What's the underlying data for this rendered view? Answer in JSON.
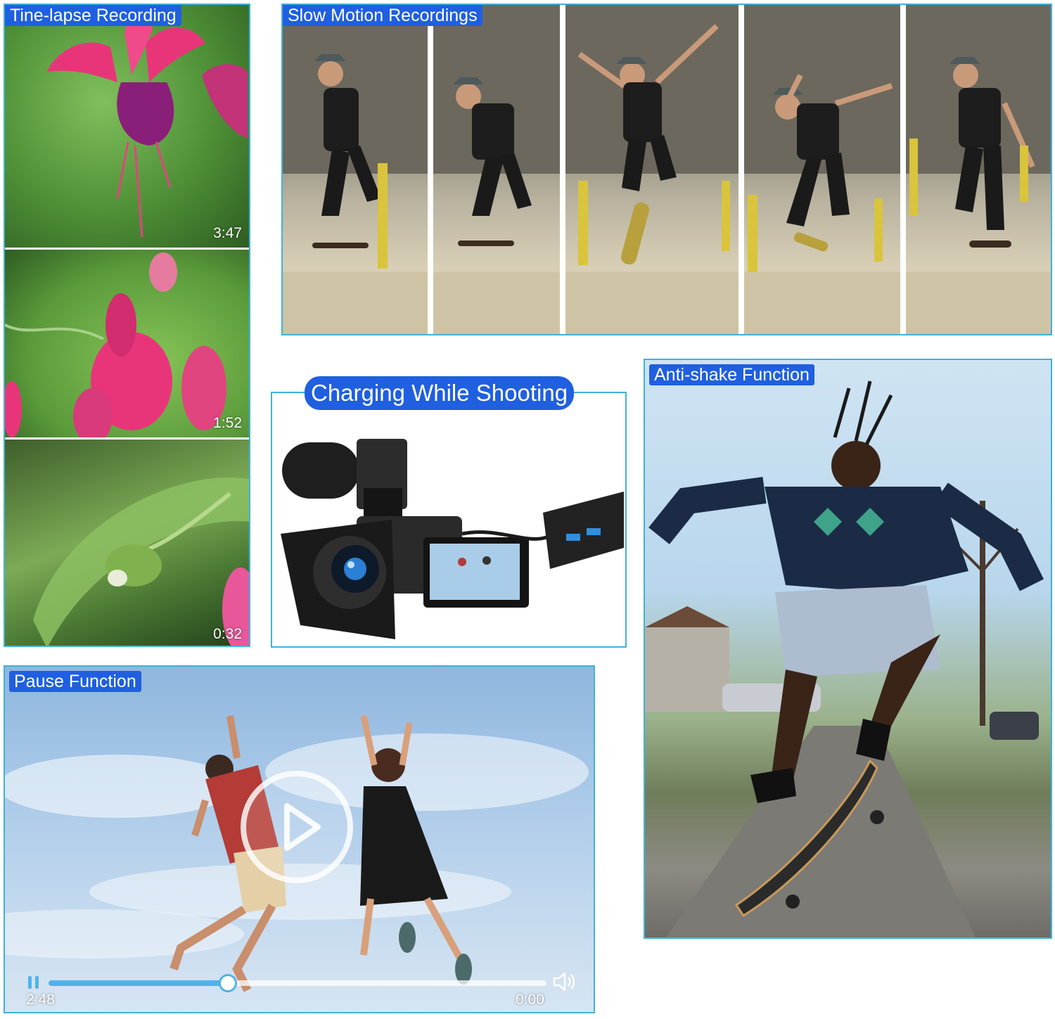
{
  "timelapse": {
    "label": "Tine-lapse Recording",
    "clips": [
      {
        "time": "3:47"
      },
      {
        "time": "1:52"
      },
      {
        "time": "0:32"
      }
    ]
  },
  "slowmo": {
    "label": "Slow Motion Recordings",
    "frame_count": 5
  },
  "charging": {
    "label": "Charging While Shooting"
  },
  "antishake": {
    "label": "Anti-shake Function"
  },
  "pause": {
    "label": "Pause Function",
    "elapsed": "2:48",
    "remaining": "0:00",
    "progress": 0.36
  },
  "icons": {
    "play": "play-icon",
    "pause": "pause-icon",
    "volume": "volume-icon"
  },
  "colors": {
    "tag_bg": "#1f5fe0",
    "tag_text": "#ffffff",
    "panel_border": "#3fb3d8",
    "seek_fill": "#4fb3ea"
  }
}
